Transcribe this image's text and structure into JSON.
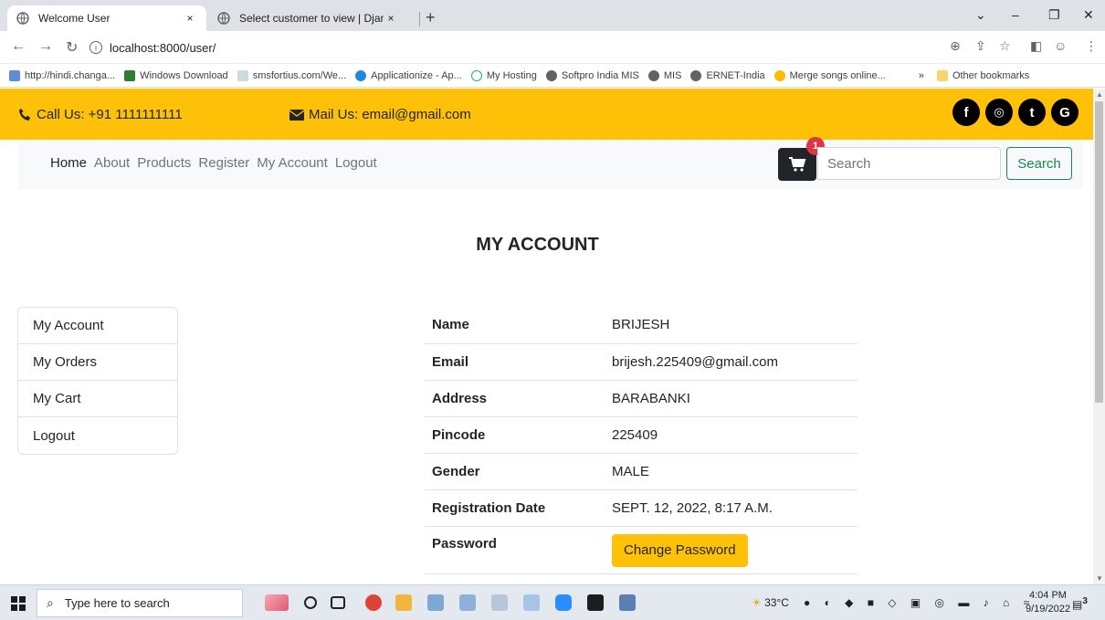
{
  "browser": {
    "tabs": [
      {
        "title": "Welcome User",
        "close": "×"
      },
      {
        "title": "Select customer to view | Django",
        "close": "×"
      }
    ],
    "new_tab": "+",
    "url": "localhost:8000/user/",
    "bookmarks": [
      "http://hindi.changa...",
      "Windows Download",
      "smsfortius.com/We...",
      "Applicationize - Ap...",
      "My Hosting",
      "Softpro India MIS",
      "MIS",
      "ERNET-India",
      "Merge songs online..."
    ],
    "more_bookmarks": "»",
    "other_bookmarks": "Other bookmarks"
  },
  "topbar": {
    "call": "Call Us: +91 1111111111",
    "mail": "Mail Us: email@gmail.com",
    "social": [
      "f",
      "◎",
      "t",
      "G"
    ]
  },
  "nav": {
    "links": [
      "Home",
      "About",
      "Products",
      "Register",
      "My Account",
      "Logout"
    ],
    "cart_count": "1",
    "search_placeholder": "Search",
    "search_button": "Search"
  },
  "page": {
    "title": "MY ACCOUNT",
    "side_menu": [
      "My Account",
      "My Orders",
      "My Cart",
      "Logout"
    ],
    "fields": [
      {
        "label": "Name",
        "value": "BRIJESH"
      },
      {
        "label": "Email",
        "value": "brijesh.225409@gmail.com"
      },
      {
        "label": "Address",
        "value": "BARABANKI"
      },
      {
        "label": "Pincode",
        "value": "225409"
      },
      {
        "label": "Gender",
        "value": "MALE"
      },
      {
        "label": "Registration Date",
        "value": "SEPT. 12, 2022, 8:17 A.M."
      }
    ],
    "password_label": "Password",
    "change_password_button": "Change Password"
  },
  "taskbar": {
    "search_placeholder": "Type here to search",
    "temperature": "33°C",
    "time": "4:04 PM",
    "date": "9/19/2022",
    "notifications": "3"
  },
  "colors": {
    "accent": "#ffc107",
    "success": "#198754",
    "danger": "#dc3545",
    "dark": "#212529"
  }
}
